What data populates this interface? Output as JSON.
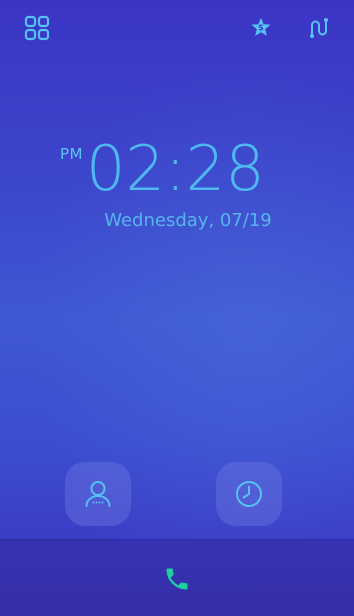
{
  "status_icons": {
    "apps": "apps-grid-icon",
    "favorites": "star-badge-icon",
    "route": "route-icon"
  },
  "clock": {
    "ampm": "PM",
    "time": "02:28",
    "date": "Wednesday, 07/19"
  },
  "shortcuts": {
    "contacts": "contact-person-icon",
    "history": "clock-history-icon"
  },
  "dock": {
    "call": "phone-icon"
  },
  "colors": {
    "accent": "#4fb8f0",
    "call_green": "#1fcfa0",
    "background_top": "#3b34c4",
    "background_mid": "#3e58d2"
  }
}
